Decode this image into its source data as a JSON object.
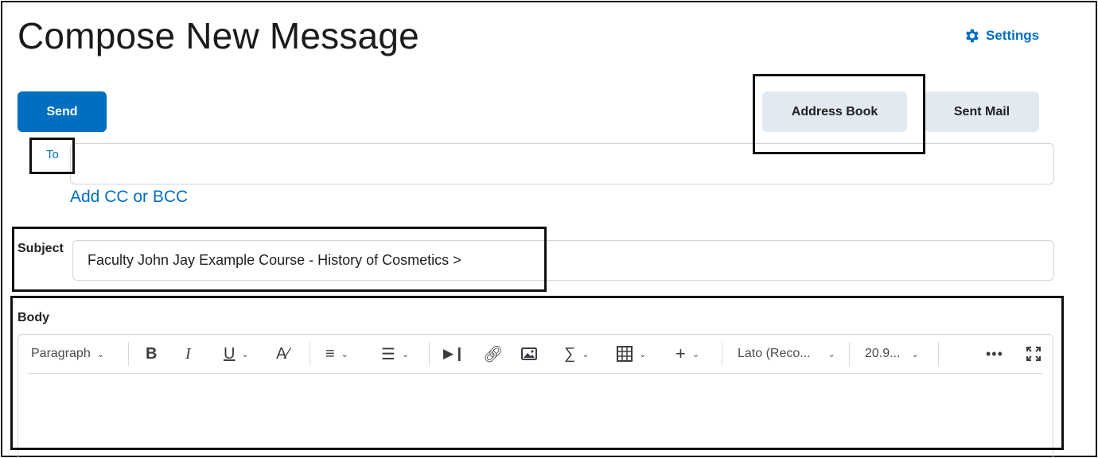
{
  "page": {
    "title": "Compose New Message",
    "settings_label": "Settings"
  },
  "actions": {
    "send_label": "Send",
    "address_book_label": "Address Book",
    "sent_mail_label": "Sent Mail"
  },
  "recipients": {
    "to_label": "To",
    "to_value": "",
    "add_cc_bcc_label": "Add CC or BCC"
  },
  "subject": {
    "label": "Subject",
    "value": "Faculty John Jay Example Course - History of Cosmetics >"
  },
  "body": {
    "label": "Body",
    "toolbar": {
      "block_format": "Paragraph",
      "font_family": "Lato (Reco...",
      "font_size": "20.9...",
      "icons": [
        "bold-icon",
        "italic-icon",
        "underline-icon",
        "text-color-icon",
        "align-icon",
        "list-icon",
        "insert-media-icon",
        "link-icon",
        "image-icon",
        "equation-icon",
        "table-icon",
        "insert-icon",
        "more-icon",
        "fullscreen-icon"
      ]
    }
  },
  "colors": {
    "primary": "#006fbf",
    "secondary_button": "#e3e9f1",
    "text": "#202122",
    "border": "#cdd5dc"
  }
}
